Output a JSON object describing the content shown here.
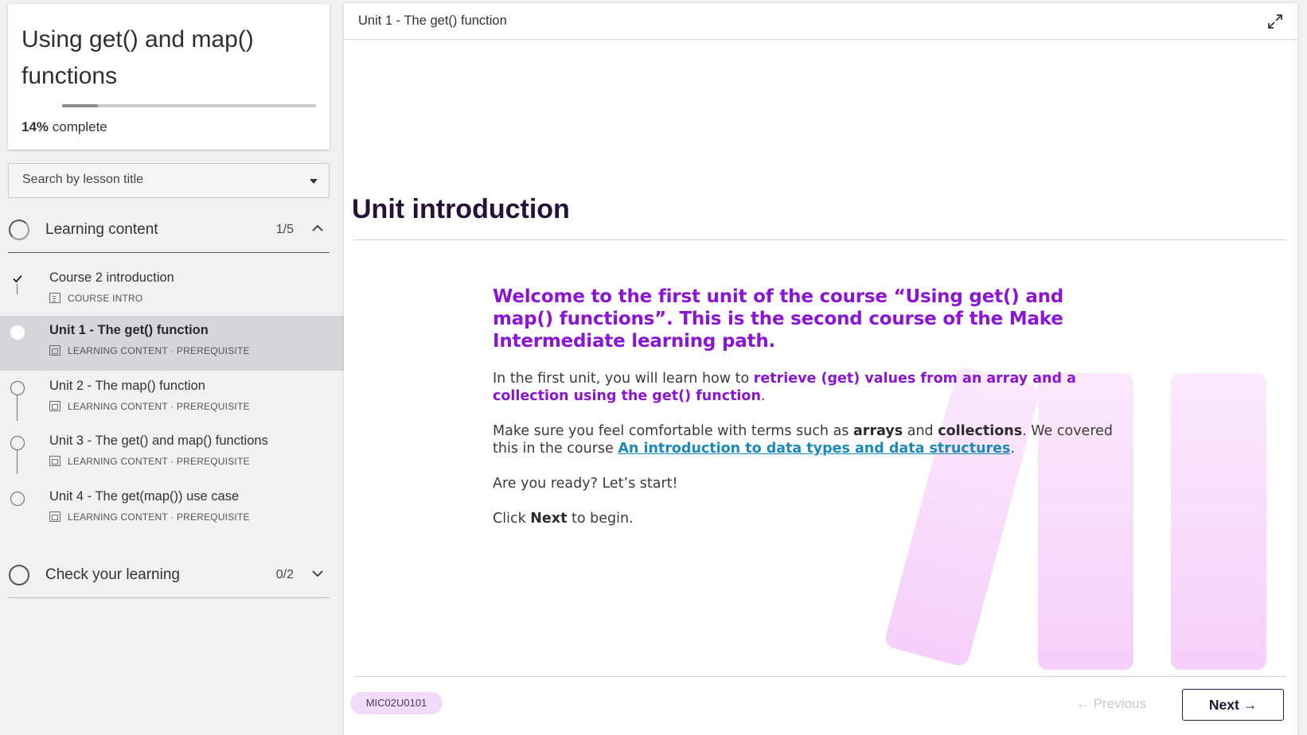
{
  "sidebar": {
    "course_title": "Using get() and map() functions",
    "progress": {
      "percent_label": "14%",
      "suffix": "complete",
      "fraction": 0.14
    },
    "search": {
      "placeholder": "Search by lesson title"
    },
    "sections": [
      {
        "title": "Learning content",
        "count": "1/5",
        "expanded": true,
        "lessons": [
          {
            "title": "Course 2 introduction",
            "meta": "COURSE INTRO",
            "icon": "course-intro-icon",
            "status": "completed"
          },
          {
            "title": "Unit 1 - The get() function",
            "meta": "LEARNING CONTENT · PREREQUISITE",
            "icon": "learning-content-icon",
            "status": "active"
          },
          {
            "title": "Unit 2 - The map() function",
            "meta": "LEARNING CONTENT · PREREQUISITE",
            "icon": "learning-content-icon",
            "status": "todo"
          },
          {
            "title": "Unit 3 - The get() and map() functions",
            "meta": "LEARNING CONTENT · PREREQUISITE",
            "icon": "learning-content-icon",
            "status": "todo"
          },
          {
            "title": "Unit 4 - The get(map()) use case",
            "meta": "LEARNING CONTENT · PREREQUISITE",
            "icon": "learning-content-icon",
            "status": "todo"
          }
        ]
      },
      {
        "title": "Check your learning",
        "count": "0/2",
        "expanded": false
      }
    ]
  },
  "main": {
    "breadcrumb": "Unit 1 - The get() function",
    "heading": "Unit introduction",
    "intro": "Welcome to the first unit of the course “Using get() and map() functions”. This is the second course of the Make Intermediate learning path.",
    "p1": {
      "before": "In the first unit, you will learn how to ",
      "highlight": "retrieve (get) values from an array and a collection using the get() function",
      "after": "."
    },
    "p2": {
      "before": "Make sure you feel comfortable with terms such as ",
      "b1": "arrays",
      "mid": " and ",
      "b2": "collections",
      "after": ". We covered this in the course ",
      "link": "An introduction to data types and data structures",
      "end": "."
    },
    "p3": "Are you ready? Let’s start!",
    "p4": {
      "before": "Click ",
      "bold": "Next",
      "after": " to begin."
    },
    "footer": {
      "code": "MIC02U0101",
      "previous": "← Previous",
      "next": "Next →"
    }
  },
  "colors": {
    "accent_purple": "#8b14d6",
    "link_blue": "#1b8ab8",
    "heading_dark": "#24123a",
    "badge_bg": "#f2dbf8",
    "deco_pink": "#f7d6fb"
  }
}
